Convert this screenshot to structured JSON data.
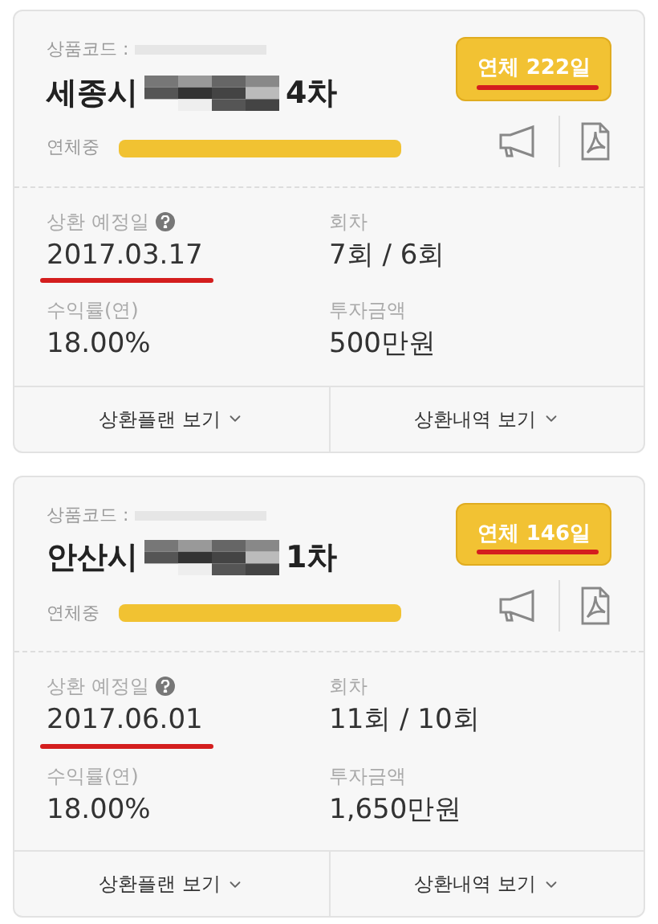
{
  "cards": [
    {
      "product_code_label": "상품코드 :",
      "title_prefix": "세종시",
      "title_suffix": "4차",
      "overdue_badge": "연체 222일",
      "status_label": "연체중",
      "level": 1,
      "fields": [
        {
          "label": "상환 예정일",
          "help": true,
          "value": "2017.03.17",
          "underlined": true
        },
        {
          "label": "회차",
          "help": false,
          "value": "7회 / 6회",
          "underlined": false
        },
        {
          "label": "수익률(연)",
          "help": false,
          "value": "18.00%",
          "underlined": false
        },
        {
          "label": "투자금액",
          "help": false,
          "value": "500만원",
          "underlined": false
        }
      ],
      "buttons": [
        "상환플랜 보기",
        "상환내역 보기"
      ]
    },
    {
      "product_code_label": "상품코드 :",
      "title_prefix": "안산시",
      "title_suffix": "1차",
      "overdue_badge": "연체 146일",
      "status_label": "연체중",
      "level": 1,
      "fields": [
        {
          "label": "상환 예정일",
          "help": true,
          "value": "2017.06.01",
          "underlined": true
        },
        {
          "label": "회차",
          "help": false,
          "value": "11회 / 10회",
          "underlined": false
        },
        {
          "label": "수익률(연)",
          "help": false,
          "value": "18.00%",
          "underlined": false
        },
        {
          "label": "투자금액",
          "help": false,
          "value": "1,650만원",
          "underlined": false
        }
      ],
      "buttons": [
        "상환플랜 보기",
        "상환내역 보기"
      ]
    }
  ]
}
